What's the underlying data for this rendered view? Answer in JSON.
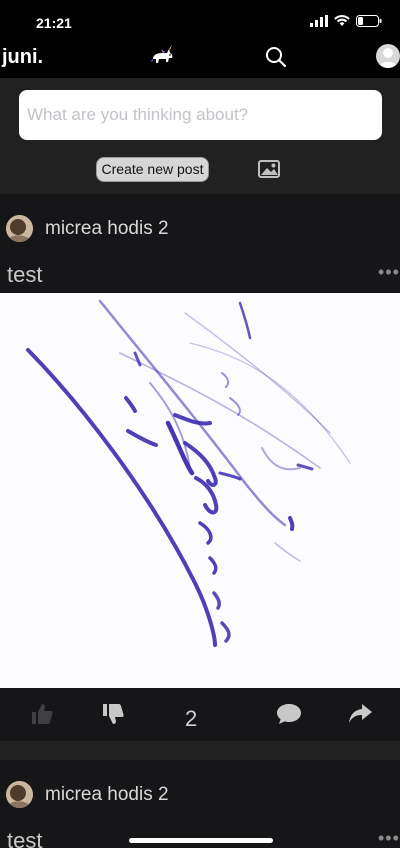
{
  "status": {
    "time": "21:21"
  },
  "header": {
    "logo": "juni."
  },
  "composer": {
    "placeholder": "What are you thinking about?",
    "create_label": "Create new post"
  },
  "posts": [
    {
      "author": "micrea hodis 2",
      "text": "test",
      "more": "•••",
      "votes": "2"
    },
    {
      "author": "micrea hodis 2",
      "text": "test",
      "more": "•••"
    }
  ],
  "colors": {
    "background": "#000000",
    "card": "#161618",
    "composer_bg": "#212122",
    "ink": "#3d2bb0"
  },
  "icons": [
    "signal-icon",
    "wifi-icon",
    "battery-icon",
    "unicorn-icon",
    "search-icon",
    "avatar-icon",
    "image-icon",
    "like-icon",
    "dislike-icon",
    "comment-icon",
    "share-icon",
    "more-icon"
  ]
}
